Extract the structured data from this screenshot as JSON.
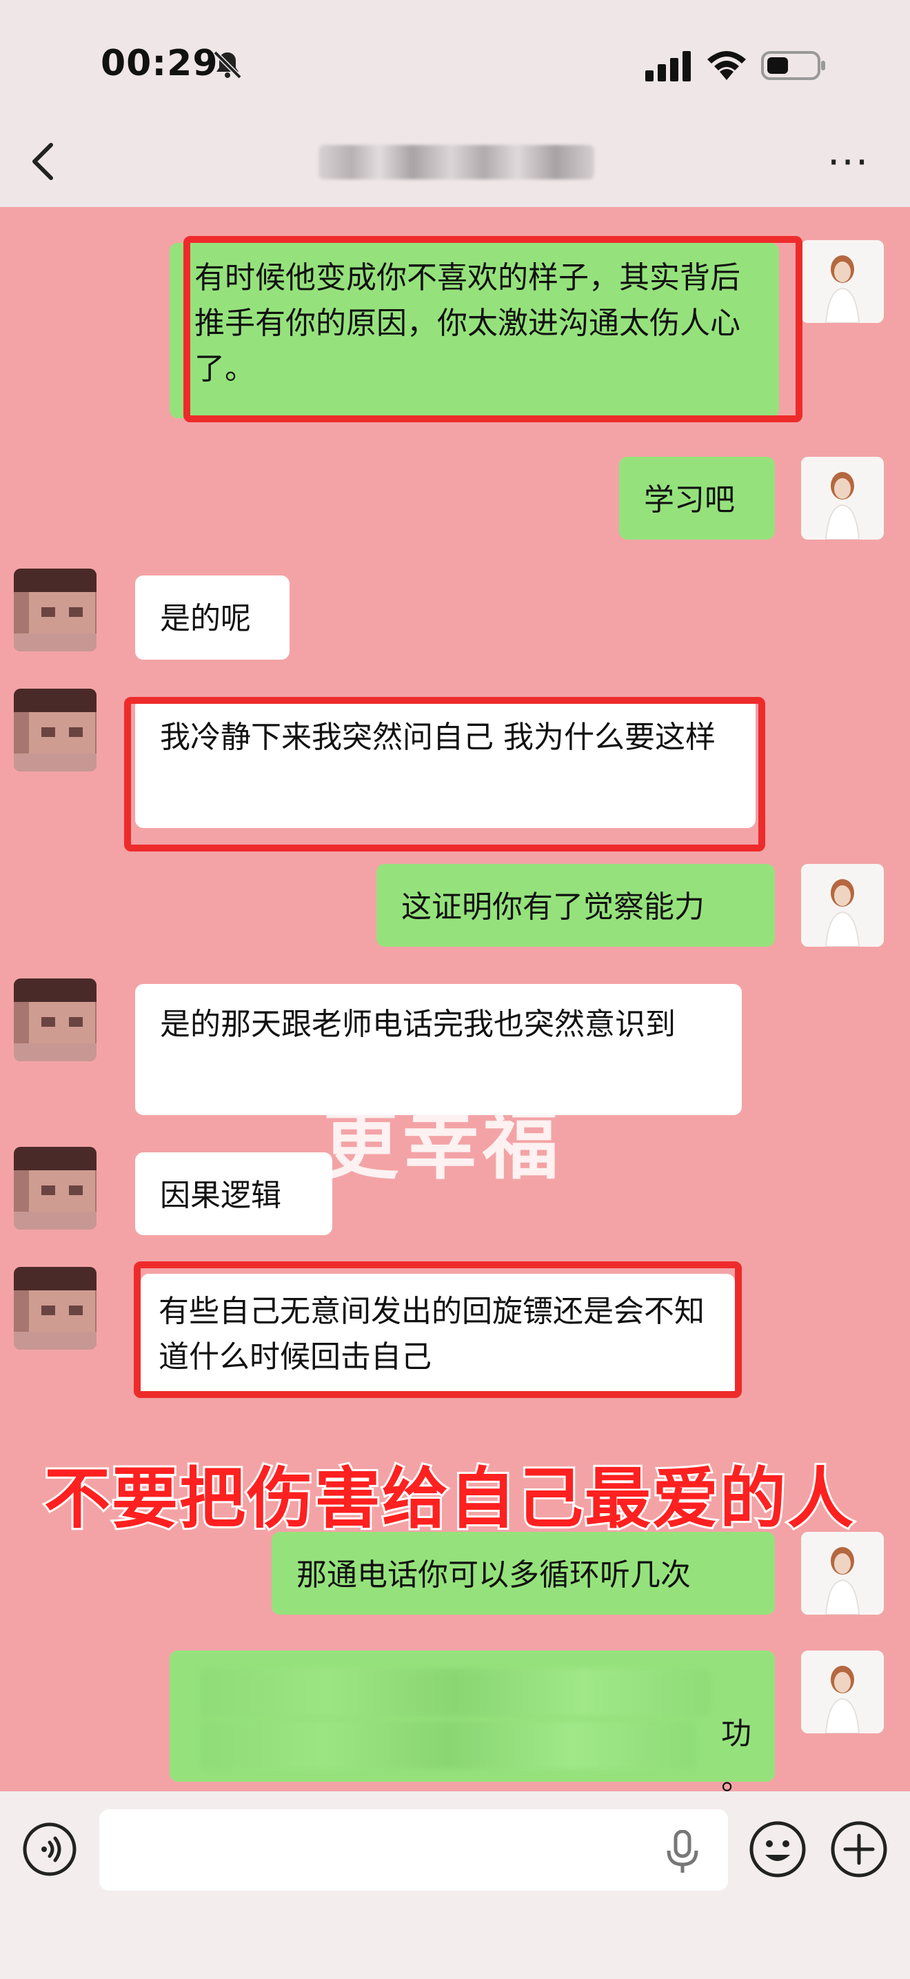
{
  "status_bar": {
    "time": "00:29",
    "icons": [
      "bell-muted-icon",
      "cellular-signal-icon",
      "wifi-icon",
      "battery-icon"
    ]
  },
  "nav": {
    "back_icon": "chevron-left-icon",
    "title": "",
    "more_label": "···"
  },
  "messages": [
    {
      "side": "self",
      "text": "有时候他变成你不喜欢的样子，其实背后推手有你的原因，你太激进沟通太伤人心了。",
      "highlighted": true
    },
    {
      "side": "self",
      "text": "学习吧",
      "highlighted": false
    },
    {
      "side": "other",
      "text": "是的呢",
      "highlighted": false
    },
    {
      "side": "other",
      "text": "我冷静下来我突然问自己 我为什么要这样",
      "highlighted": true
    },
    {
      "side": "self",
      "text": "这证明你有了觉察能力",
      "highlighted": false
    },
    {
      "side": "other",
      "text": "是的那天跟老师电话完我也突然意识到",
      "highlighted": false
    },
    {
      "side": "other",
      "text": "因果逻辑",
      "highlighted": false
    },
    {
      "side": "other",
      "text": "有些自己无意间发出的回旋镖还是会不知道什么时候回击自己",
      "highlighted": true
    },
    {
      "side": "self",
      "text": "那通电话你可以多循环听几次",
      "highlighted": false
    },
    {
      "side": "self",
      "text": "功\n。",
      "highlighted": false
    }
  ],
  "watermark": "更幸福",
  "caption": "不要把伤害给自己最爱的人",
  "input_bar": {
    "voice_icon": "voice-mode-icon",
    "mic_icon": "microphone-icon",
    "emoji_icon": "emoji-icon",
    "plus_icon": "plus-circle-icon"
  },
  "colors": {
    "chat_background": "#f3a3a6",
    "self_bubble": "#95e27c",
    "other_bubble": "#ffffff",
    "highlight_border": "#ee2b2b",
    "caption_red": "#ff2020"
  }
}
